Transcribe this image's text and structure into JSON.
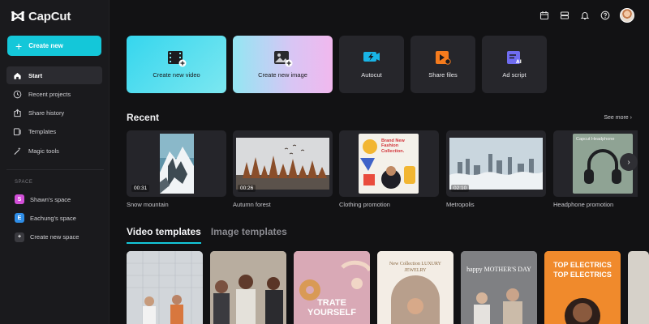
{
  "app": {
    "name": "CapCut"
  },
  "sidebar": {
    "create_label": "Create new",
    "nav": [
      {
        "label": "Start",
        "icon": "home-icon",
        "active": true
      },
      {
        "label": "Recent projects",
        "icon": "clock-icon"
      },
      {
        "label": "Share history",
        "icon": "share-icon"
      },
      {
        "label": "Templates",
        "icon": "templates-icon"
      },
      {
        "label": "Magic tools",
        "icon": "magic-wand-icon"
      }
    ],
    "space_label": "SPACE",
    "spaces": [
      {
        "initial": "S",
        "label": "Shawn's space",
        "color": "#d24fd8"
      },
      {
        "initial": "E",
        "label": "Eachung's space",
        "color": "#2f8ee8"
      },
      {
        "initial": "+",
        "label": "Create new space",
        "color": "#3a3a3f"
      }
    ]
  },
  "quick_actions": [
    {
      "label": "Create new video",
      "icon": "film-plus-icon"
    },
    {
      "label": "Create new image",
      "icon": "image-plus-icon"
    },
    {
      "label": "Autocut",
      "icon": "autocut-icon"
    },
    {
      "label": "Share files",
      "icon": "share-files-icon"
    },
    {
      "label": "Ad script",
      "icon": "ad-script-icon"
    }
  ],
  "recent": {
    "title": "Recent",
    "see_more": "See more",
    "items": [
      {
        "label": "Snow mountain",
        "duration": "00:31"
      },
      {
        "label": "Autumn forest",
        "duration": "00:26"
      },
      {
        "label": "Clothing promotion",
        "duration": "",
        "poster_text": "Brand New Fashion Collection."
      },
      {
        "label": "Metropolis",
        "duration": "02:10"
      },
      {
        "label": "Headphone promotion",
        "duration": "",
        "poster_text": "Capcut Headphone"
      }
    ]
  },
  "templates": {
    "tabs": [
      {
        "label": "Video templates",
        "active": true
      },
      {
        "label": "Image templates",
        "active": false
      }
    ],
    "items": [
      {
        "text": ""
      },
      {
        "text": ""
      },
      {
        "text": "TRATE YOURSELF"
      },
      {
        "text": "New Collection LUXURY JEWELRY"
      },
      {
        "text": "happy MOTHER'S DAY"
      },
      {
        "text": "TOP ELECTRICS TOP ELECTRICS"
      }
    ]
  },
  "colors": {
    "accent": "#14c7d9",
    "bg": "#121214",
    "sidebar": "#1a1a1d"
  }
}
